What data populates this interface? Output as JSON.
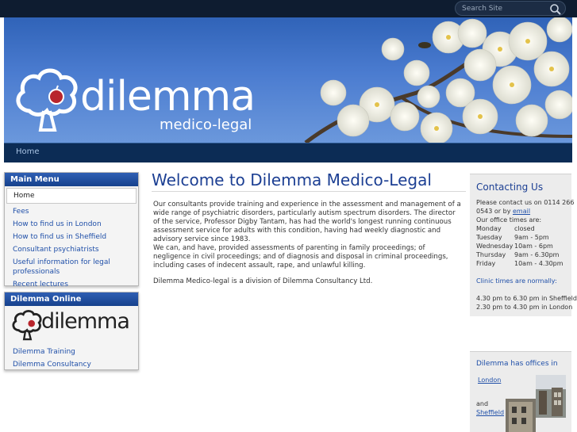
{
  "search": {
    "placeholder": "Search Site"
  },
  "nav": {
    "home": "Home"
  },
  "logo": {
    "word": "dilemma",
    "sub": "medico-legal"
  },
  "main_menu": {
    "title": "Main Menu",
    "items": [
      {
        "label": "Home"
      },
      {
        "label": "Fees"
      },
      {
        "label": "How to find us in London"
      },
      {
        "label": "How to find us in Sheffield"
      },
      {
        "label": "Consultant psychiatrists"
      },
      {
        "label": "Useful information for legal professionals"
      },
      {
        "label": "Recent lectures"
      }
    ]
  },
  "online": {
    "title": "Dilemma Online",
    "logo_word": "dilemma",
    "links": [
      {
        "label": "Dilemma Training"
      },
      {
        "label": "Dilemma Consultancy"
      }
    ]
  },
  "main": {
    "title": "Welcome to Dilemma Medico-Legal",
    "p1": "Our consultants provide training and experience in the assessment and management of a wide range of psychiatric disorders, particularly autism spectrum disorders.  The director of the service, Professor Digby Tantam, has had the world's longest running continuous assessment service for adults with this condition, having had weekly diagnostic and advisory service since 1983.",
    "p1b": "We can, and have, provided assessments of parenting in family proceedings; of negligence in civil proceedings; and of diagnosis and disposal in criminal proceedings, including cases of indecent assault, rape, and unlawful killing.",
    "p2": "Dilemma Medico-legal is a division of Dilemma Consultancy Ltd."
  },
  "contact": {
    "title": "Contacting Us",
    "line1": "Please contact us on 0114 266",
    "line2_pre": "0543 or by ",
    "email_link": "email",
    "office_times": "Our office times are:",
    "hours": [
      {
        "day": "Monday",
        "time": "closed"
      },
      {
        "day": "Tuesday",
        "time": "9am - 5pm"
      },
      {
        "day": "Wednesday",
        "time": "10am - 6pm"
      },
      {
        "day": "Thursday",
        "time": "9am - 6.30pm"
      },
      {
        "day": "Friday",
        "time": "10am - 4.30pm"
      }
    ],
    "clinic_title": "Clinic times are normally:",
    "clinic1": "4.30 pm to 6.30 pm in Sheffield",
    "clinic2": "2.30 pm to 4.30 pm in London"
  },
  "offices": {
    "title": "Dilemma has offices in",
    "london": "London",
    "and": "and",
    "sheffield": "Sheffield"
  }
}
